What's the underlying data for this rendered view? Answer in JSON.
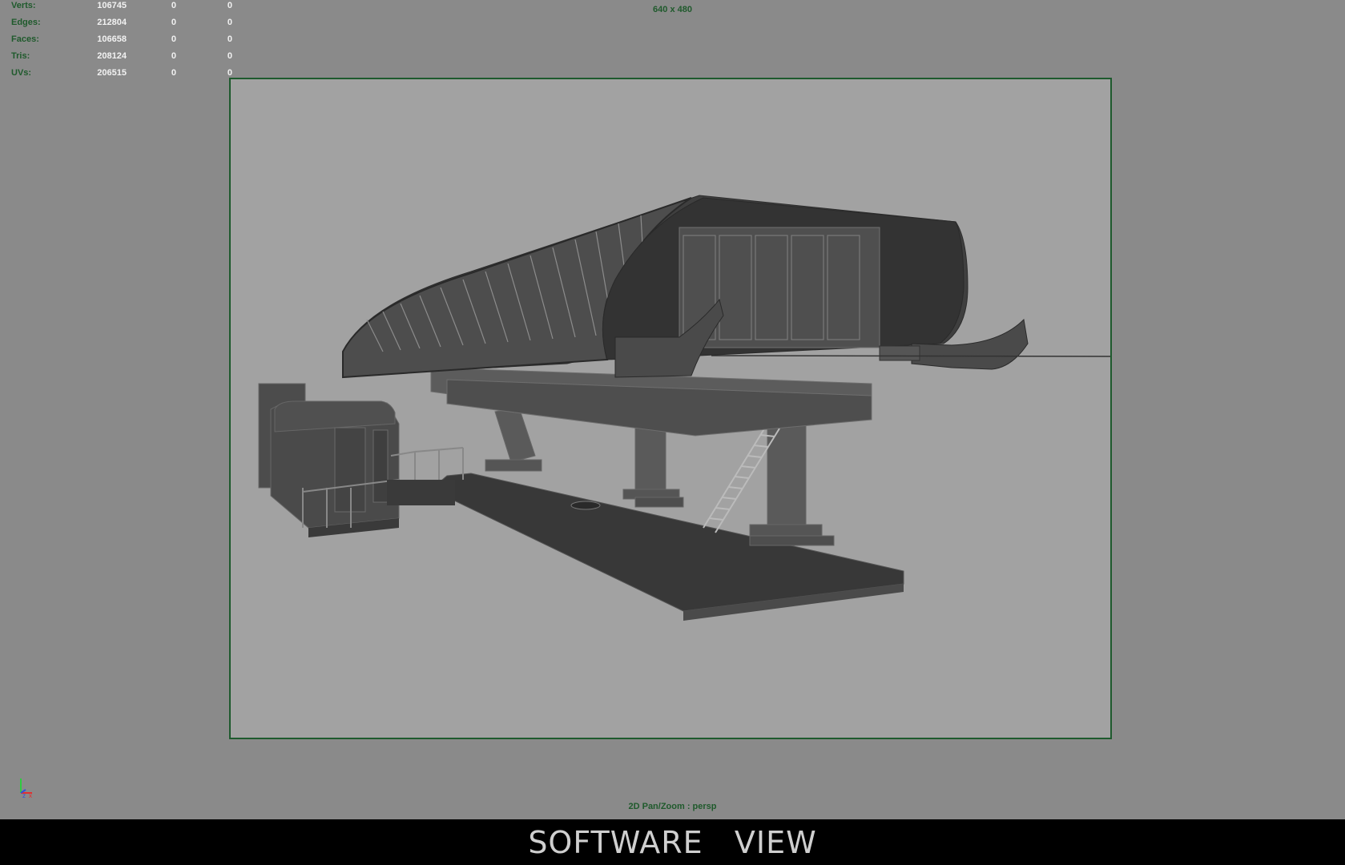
{
  "hud": {
    "rows": [
      {
        "label": "Verts:",
        "v1": "106745",
        "v2": "0",
        "v3": "0"
      },
      {
        "label": "Edges:",
        "v1": "212804",
        "v2": "0",
        "v3": "0"
      },
      {
        "label": "Faces:",
        "v1": "106658",
        "v2": "0",
        "v3": "0"
      },
      {
        "label": "Tris:",
        "v1": "208124",
        "v2": "0",
        "v3": "0"
      },
      {
        "label": "UVs:",
        "v1": "206515",
        "v2": "0",
        "v3": "0"
      }
    ]
  },
  "viewport": {
    "resolution": "640 x 480",
    "camera_label": "2D Pan/Zoom : persp",
    "axis_labels": {
      "y": "y",
      "z": "z",
      "x": "x"
    }
  },
  "footer": {
    "title": "SOFTWARE   VIEW"
  },
  "colors": {
    "hud_label": "#1f5a2c",
    "hud_value": "#f2f2f2",
    "viewport_bg": "#8a8a8a",
    "gate_bg": "#a2a2a2",
    "gate_border": "#1e5a2e",
    "model_dark": "#3c3c3c",
    "footer_bg": "#000000"
  }
}
